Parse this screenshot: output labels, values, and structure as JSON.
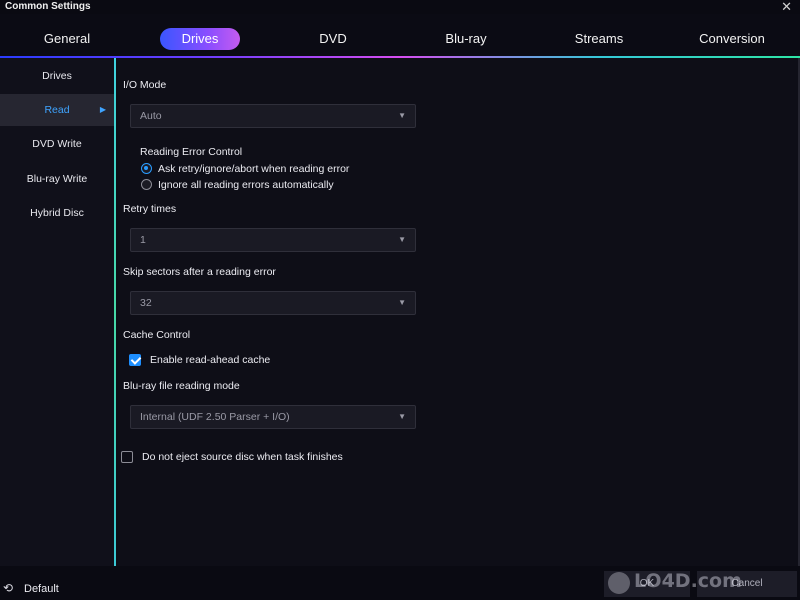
{
  "window": {
    "title": "Common Settings",
    "close_glyph": "✕"
  },
  "tabs": [
    {
      "label": "General",
      "active": false
    },
    {
      "label": "Drives",
      "active": true
    },
    {
      "label": "DVD",
      "active": false
    },
    {
      "label": "Blu-ray",
      "active": false
    },
    {
      "label": "Streams",
      "active": false
    },
    {
      "label": "Conversion",
      "active": false
    }
  ],
  "sidebar": {
    "items": [
      {
        "label": "Drives"
      },
      {
        "label": "Read",
        "active": true
      },
      {
        "label": "DVD Write"
      },
      {
        "label": "Blu-ray Write"
      },
      {
        "label": "Hybrid Disc"
      }
    ]
  },
  "read_settings": {
    "io_mode": {
      "label": "I/O Mode",
      "value": "Auto"
    },
    "reading_error_control": {
      "label": "Reading Error Control",
      "options": [
        {
          "label": "Ask retry/ignore/abort when reading error",
          "selected": true
        },
        {
          "label": "Ignore all reading errors automatically",
          "selected": false
        }
      ]
    },
    "retry_times": {
      "label": "Retry times",
      "value": "1"
    },
    "skip_sectors": {
      "label": "Skip sectors after a reading error",
      "value": "32"
    },
    "cache_control": {
      "label": "Cache Control",
      "read_ahead_label": "Enable read-ahead cache",
      "read_ahead_checked": true
    },
    "bluray_reading_mode": {
      "label": "Blu-ray file reading mode",
      "value": "Internal (UDF 2.50 Parser + I/O)"
    },
    "no_eject": {
      "label": "Do not eject source disc when task finishes",
      "checked": false
    }
  },
  "footer": {
    "default_label": "Default",
    "ok_label": "OK",
    "cancel_label": "Cancel"
  },
  "watermark": {
    "text": "LO4D.com"
  },
  "colors": {
    "accent": "#1e8fff",
    "active_sidebar_text": "#3fa4ff",
    "background": "#0d0d16"
  }
}
